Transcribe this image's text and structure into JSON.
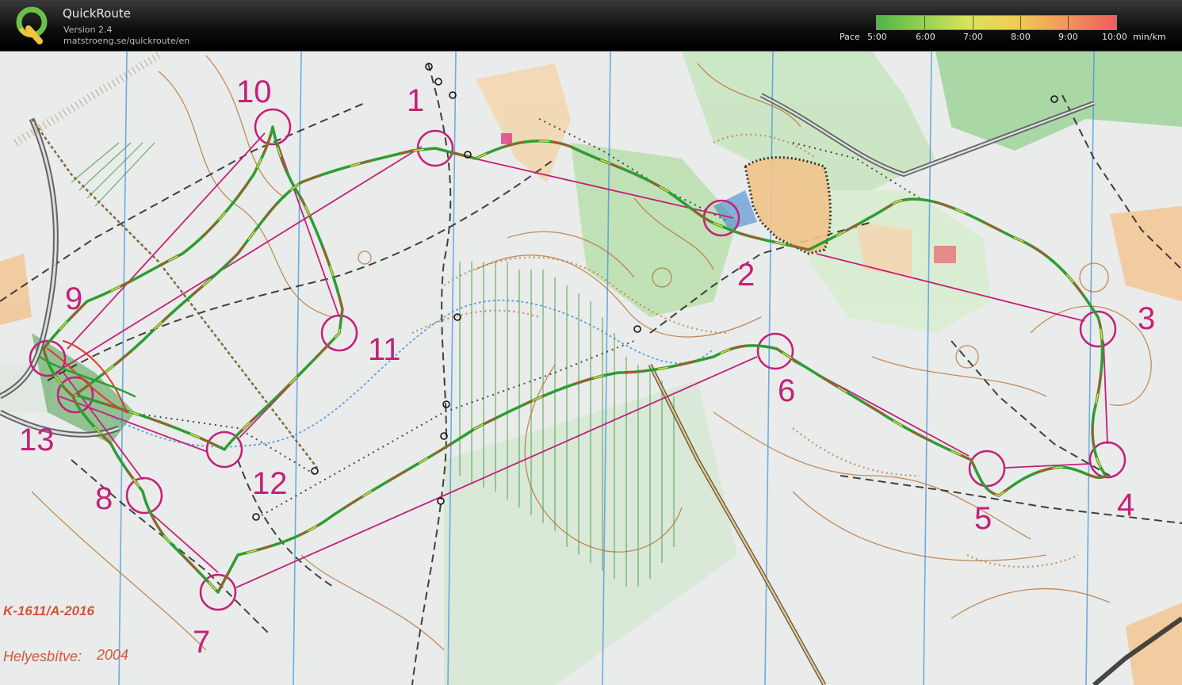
{
  "app": {
    "title": "QuickRoute",
    "version": "Version 2.4",
    "url": "matstroeng.se/quickroute/en"
  },
  "pace_scale": {
    "label": "Pace",
    "ticks": [
      "5:00",
      "6:00",
      "7:00",
      "8:00",
      "9:00",
      "10:00"
    ],
    "unit": "min/km",
    "colors": [
      "#4fb547",
      "#8fcf54",
      "#d8e35a",
      "#f0cc57",
      "#f09a5c",
      "#ee5d5d"
    ]
  },
  "map": {
    "course_color": "#c4207a",
    "route_colors": [
      "#2e9c33",
      "#e03a2a",
      "#e8d43a"
    ],
    "sheet_code": "K-1611/A-2016",
    "updated_label": "Helyesbítve:",
    "updated_year": "2004",
    "controls": [
      "1",
      "2",
      "3",
      "4",
      "5",
      "6",
      "7",
      "8",
      "9",
      "10",
      "11",
      "12",
      "13"
    ]
  }
}
